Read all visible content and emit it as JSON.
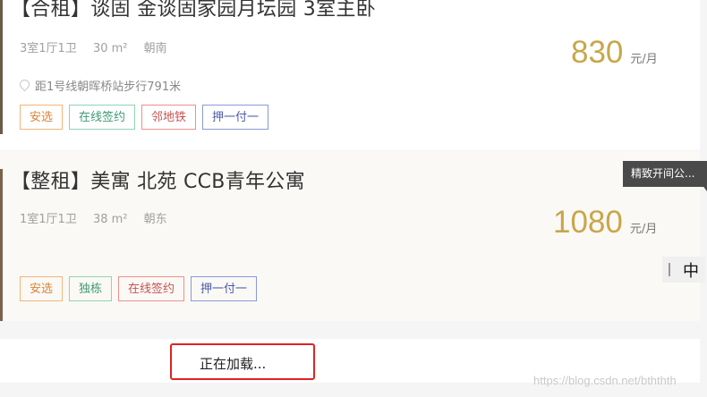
{
  "listings": [
    {
      "title": "【合租】谈固 金谈固家园月坛园 3室主卧",
      "layout": "3室1厅1卫",
      "area": "30 m²",
      "orientation": "朝南",
      "location": "距1号线朝晖桥站步行791米",
      "price": "830",
      "price_unit": "元/月",
      "tags": [
        "安选",
        "在线签约",
        "邻地铁",
        "押一付一"
      ]
    },
    {
      "title": "【整租】美寓 北苑 CCB青年公寓",
      "layout": "1室1厅1卫",
      "area": "38 m²",
      "orientation": "朝东",
      "price": "1080",
      "price_unit": "元/月",
      "tags": [
        "安选",
        "独栋",
        "在线签约",
        "押一付一"
      ]
    }
  ],
  "tooltip": {
    "text": "精致开间公..."
  },
  "ime": {
    "char": "中"
  },
  "loading": {
    "text": "正在加载..."
  },
  "watermark": "https://blog.csdn.net/bththth",
  "colors": {
    "price": "#c9a64a",
    "highlight_border": "#e02222"
  }
}
